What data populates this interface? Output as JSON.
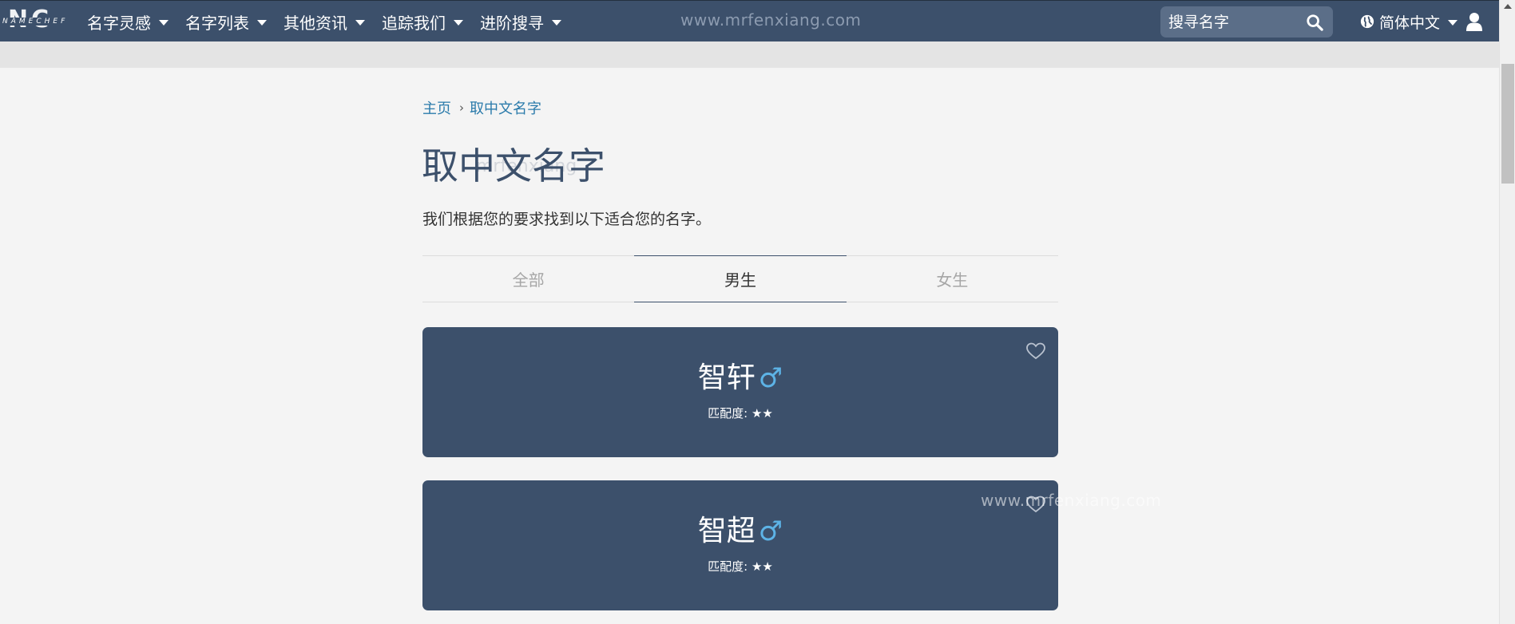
{
  "nav": {
    "logo_big": "NC",
    "logo_small": "NAMECHEF",
    "items": [
      {
        "label": "名字灵感"
      },
      {
        "label": "名字列表"
      },
      {
        "label": "其他资讯"
      },
      {
        "label": "追踪我们"
      },
      {
        "label": "进阶搜寻"
      }
    ],
    "watermark": "www.mrfenxiang.com",
    "search_placeholder": "搜寻名字",
    "language": "简体中文"
  },
  "breadcrumb": {
    "home": "主页",
    "separator": "›",
    "current": "取中文名字"
  },
  "page": {
    "title": "取中文名字",
    "title_watermark": "mrfenxiang",
    "intro": "我们根据您的要求找到以下适合您的名字。"
  },
  "tabs": [
    {
      "label": "全部",
      "active": false
    },
    {
      "label": "男生",
      "active": true
    },
    {
      "label": "女生",
      "active": false
    }
  ],
  "results": [
    {
      "name": "智轩",
      "gender_symbol": "♂",
      "match_label": "匹配度:",
      "match_stars": "★★",
      "rating": 2
    },
    {
      "name": "智超",
      "gender_symbol": "♂",
      "match_label": "匹配度:",
      "match_stars": "★★",
      "rating": 2
    }
  ],
  "watermark_overlay": "www.mrfenxiang.com",
  "colors": {
    "brand": "#3c506b",
    "link": "#2b7bab",
    "male": "#5db3e6",
    "background": "#f4f4f4"
  },
  "icons": [
    "search-icon",
    "globe-icon",
    "user-icon",
    "heart-icon",
    "chevron-down-icon"
  ]
}
